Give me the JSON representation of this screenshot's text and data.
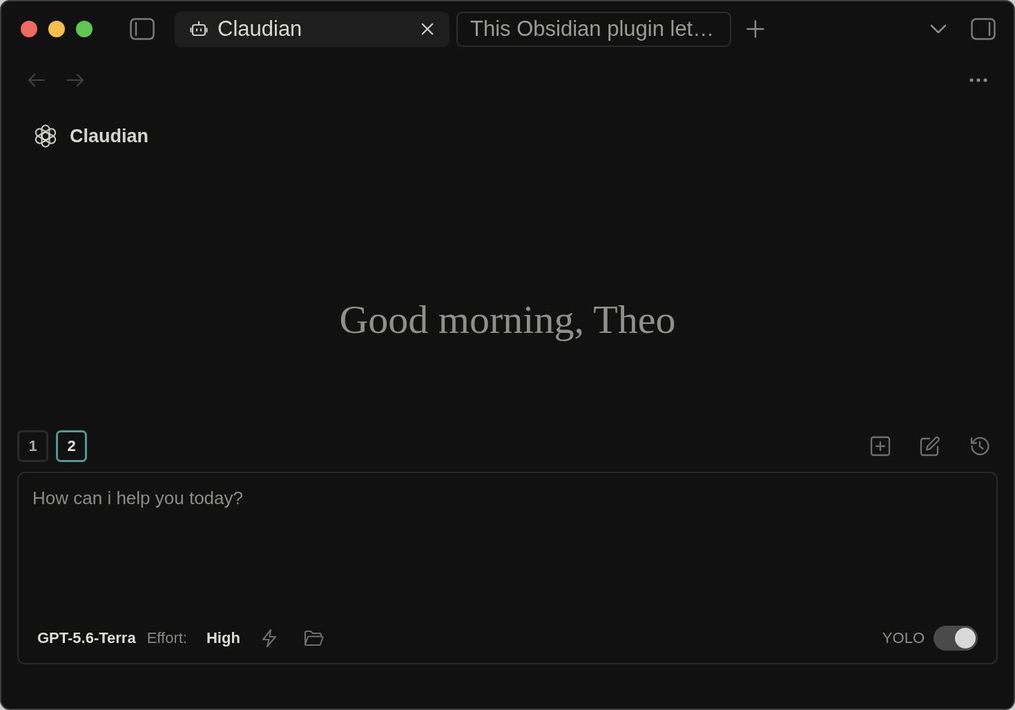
{
  "window": {
    "controls": [
      {
        "color": "#ee6a5f"
      },
      {
        "color": "#f5bf4f"
      },
      {
        "color": "#61c554"
      }
    ]
  },
  "tabs": [
    {
      "kind": "plugin_view",
      "title": "Claudian",
      "selected": true,
      "closable": true
    },
    {
      "kind": "note",
      "title": "This Obsidian plugin let…",
      "selected": false,
      "closable": false
    }
  ],
  "nav": {
    "back": {
      "disabled": true
    },
    "forward": {
      "disabled": true
    }
  },
  "header": {
    "title": "Claudian"
  },
  "greeting": "Good morning, Theo",
  "sessions": [
    {
      "label": "1",
      "selected": false
    },
    {
      "label": "2",
      "selected": true
    }
  ],
  "composer": {
    "placeholder": "How can i help you today?",
    "model": "GPT-5.6-Terra",
    "effort_label": "Effort:",
    "effort": "High",
    "yolo": {
      "label": "YOLO",
      "on": true
    }
  }
}
